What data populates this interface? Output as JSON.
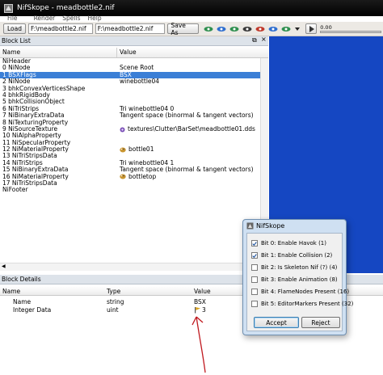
{
  "window": {
    "title": "NifSkope - meadbottle2.nif"
  },
  "menu": [
    "File",
    "Render",
    "Spells",
    "Help"
  ],
  "toolbar": {
    "load_label": "Load",
    "load_path": "F:\\meadbottle2.nif",
    "save_path": "F:\\meadbottle2.nif",
    "save_as_label": "Save As",
    "time_value": "0.00"
  },
  "block_list": {
    "title": "Block List",
    "columns": [
      "Name",
      "Value"
    ],
    "rows": [
      {
        "name": "NiHeader",
        "value": ""
      },
      {
        "name": "0  NiNode",
        "value": "Scene Root"
      },
      {
        "name": "1  BSXFlags",
        "value": "BSX",
        "selected": true
      },
      {
        "name": "2  NiNode",
        "value": "winebottle04"
      },
      {
        "name": "3  bhkConvexVerticesShape",
        "value": ""
      },
      {
        "name": "4  bhkRigidBody",
        "value": ""
      },
      {
        "name": "5  bhkCollisionObject",
        "value": ""
      },
      {
        "name": "6  NiTriStrips",
        "value": "Tri winebottle04 0"
      },
      {
        "name": "7  NiBinaryExtraData",
        "value": "Tangent space (binormal & tangent vectors)"
      },
      {
        "name": "8  NiTexturingProperty",
        "value": ""
      },
      {
        "name": "9  NiSourceTexture",
        "value": "textures\\Clutter\\BarSet\\meadbottle01.dds",
        "icon": "texture-icon"
      },
      {
        "name": "10 NiAlphaProperty",
        "value": ""
      },
      {
        "name": "11 NiSpecularProperty",
        "value": ""
      },
      {
        "name": "12 NiMaterialProperty",
        "value": "bottle01",
        "icon": "palette-icon"
      },
      {
        "name": "13 NiTriStripsData",
        "value": ""
      },
      {
        "name": "14 NiTriStrips",
        "value": "Tri winebottle04 1"
      },
      {
        "name": "15 NiBinaryExtraData",
        "value": "Tangent space (binormal & tangent vectors)"
      },
      {
        "name": "16 NiMaterialProperty",
        "value": "bottletop",
        "icon": "palette-icon"
      },
      {
        "name": "17 NiTriStripsData",
        "value": ""
      },
      {
        "name": "NiFooter",
        "value": ""
      }
    ]
  },
  "block_details": {
    "title": "Block Details",
    "columns": [
      "Name",
      "Type",
      "Value"
    ],
    "rows": [
      {
        "name": "Name",
        "type": "string",
        "value": "BSX"
      },
      {
        "name": "Integer Data",
        "type": "uint",
        "value": "3"
      }
    ]
  },
  "dialog": {
    "title": "NifSkope",
    "options": [
      {
        "label": "Bit 0: Enable Havok (1)",
        "checked": true
      },
      {
        "label": "Bit 1: Enable Collision (2)",
        "checked": true
      },
      {
        "label": "Bit 2: Is Skeleton Nif (?) (4)",
        "checked": false
      },
      {
        "label": "Bit 3: Enable Animation (8)",
        "checked": false
      },
      {
        "label": "Bit 4: FlameNodes Present (16)",
        "checked": false
      },
      {
        "label": "Bit 5: EditorMarkers Present (32)",
        "checked": false
      }
    ],
    "accept_label": "Accept",
    "reject_label": "Reject"
  },
  "colors": {
    "selection": "#3b7fd6",
    "viewport": "#1547c2",
    "annotation": "#c0191f"
  }
}
